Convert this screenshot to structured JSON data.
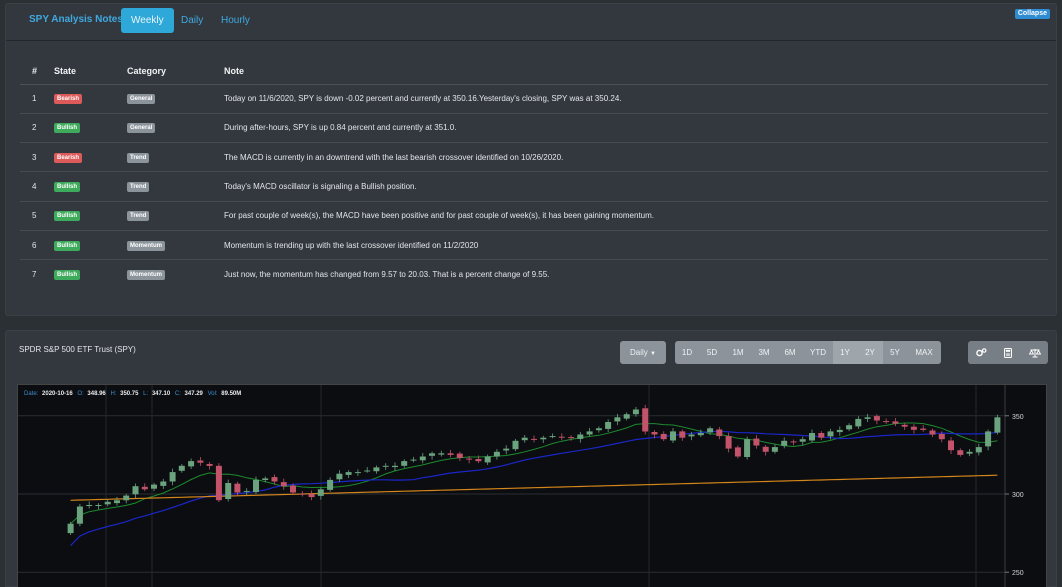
{
  "nav": {
    "title": "SPY Analysis Notes",
    "tabs": [
      "Weekly",
      "Daily",
      "Hourly"
    ],
    "active_tab": "Weekly",
    "collapse_label": "Collapse"
  },
  "notes_table": {
    "headers": [
      "#",
      "State",
      "Category",
      "Note"
    ],
    "rows": [
      {
        "num": "1",
        "state": "Bearish",
        "category": "General",
        "note": "Today on 11/6/2020, SPY is down -0.02 percent and currently at 350.16.Yesterday's closing, SPY was at 350.24."
      },
      {
        "num": "2",
        "state": "Bullish",
        "category": "General",
        "note": "During after-hours, SPY is up 0.84 percent and currently at 351.0."
      },
      {
        "num": "3",
        "state": "Bearish",
        "category": "Trend",
        "note": "The MACD is currently in an downtrend with the last bearish crossover identified on 10/26/2020."
      },
      {
        "num": "4",
        "state": "Bullish",
        "category": "Trend",
        "note": "Today's MACD oscillator is signaling a Bullish position."
      },
      {
        "num": "5",
        "state": "Bullish",
        "category": "Trend",
        "note": "For past couple of week(s), the MACD have been positive and for past couple of week(s), it has been gaining momentum."
      },
      {
        "num": "6",
        "state": "Bullish",
        "category": "Momentum",
        "note": "Momentum is trending up with the last crossover identified on 11/2/2020"
      },
      {
        "num": "7",
        "state": "Bullish",
        "category": "Momentum",
        "note": "Just now, the momentum has changed from 9.57 to 20.03. That is a percent change of 9.55."
      }
    ]
  },
  "chart_panel": {
    "title": "SPDR S&P 500 ETF Trust (SPY)",
    "interval_label": "Daily",
    "ranges": [
      "1D",
      "5D",
      "1M",
      "3M",
      "6M",
      "YTD",
      "1Y",
      "2Y",
      "5Y",
      "MAX"
    ],
    "selected_ranges": [
      "1Y",
      "2Y"
    ],
    "tool_icons": [
      "gears-icon",
      "calculator-icon",
      "balance-scale-icon"
    ]
  },
  "chart_data": {
    "type": "candlestick",
    "info": {
      "date_label": "Date:",
      "date": "2020-10-16",
      "open_label": "O:",
      "open": "348.96",
      "high_label": "H:",
      "high": "350.75",
      "low_label": "L:",
      "low": "347.10",
      "close_label": "C:",
      "close": "347.29",
      "vol_label": "Vol:",
      "vol": "89.50M"
    },
    "y_ticks": [
      350,
      300,
      250
    ],
    "ylim": [
      238,
      362
    ],
    "closes": [
      281,
      292,
      293,
      293,
      295,
      296,
      299,
      305,
      303,
      306,
      308,
      314,
      318,
      321,
      320,
      318,
      296,
      307,
      301,
      302,
      309,
      310,
      308,
      305,
      301,
      300,
      298,
      303,
      309,
      313,
      314,
      314,
      315,
      317,
      318,
      318,
      321,
      322,
      324,
      326,
      326,
      325,
      323,
      322,
      321,
      324,
      327,
      329,
      334,
      336,
      335,
      336,
      337,
      336,
      336,
      338,
      340,
      342,
      346,
      349,
      351,
      354,
      340,
      338,
      335,
      340,
      336,
      338,
      339,
      342,
      337,
      329,
      324,
      335,
      331,
      327,
      330,
      334,
      333,
      335,
      339,
      336,
      340,
      341,
      344,
      348,
      349,
      347,
      346,
      345,
      343,
      341,
      341,
      338,
      335,
      328,
      325,
      327,
      330,
      340,
      349
    ]
  }
}
